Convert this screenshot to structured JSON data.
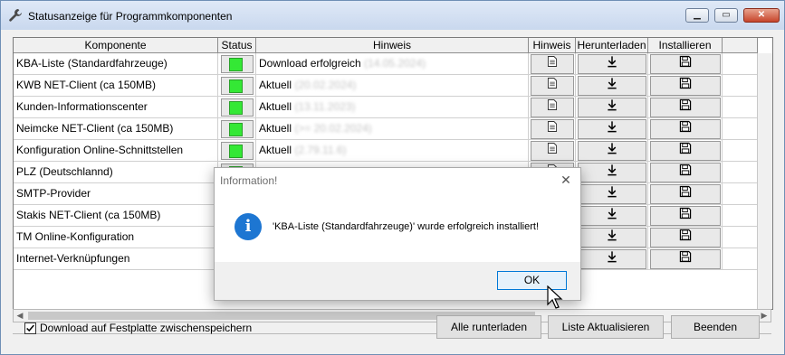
{
  "window": {
    "title": "Statusanzeige für Programmkomponenten",
    "minimize_glyph": "▁",
    "maximize_glyph": "▭",
    "close_glyph": "✕"
  },
  "table": {
    "headers": [
      "Komponente",
      "Status",
      "Hinweis",
      "Hinweis",
      "Herunterladen",
      "Installieren"
    ],
    "rows": [
      {
        "name": "KBA-Liste (Standardfahrzeuge)",
        "status": "green",
        "hint": "Download erfolgreich",
        "hint_detail": "(14.05.2024)"
      },
      {
        "name": "KWB NET-Client (ca 150MB)",
        "status": "green",
        "hint": "Aktuell",
        "hint_detail": "(20.02.2024)"
      },
      {
        "name": "Kunden-Informationscenter",
        "status": "green",
        "hint": "Aktuell",
        "hint_detail": "(13.11.2023)"
      },
      {
        "name": "Neimcke NET-Client (ca 150MB)",
        "status": "green",
        "hint": "Aktuell",
        "hint_detail": "(>= 20.02.2024)"
      },
      {
        "name": "Konfiguration Online-Schnittstellen",
        "status": "green",
        "hint": "Aktuell",
        "hint_detail": "(2.79.11.6)"
      },
      {
        "name": "PLZ (Deutschlannd)",
        "status": "green",
        "hint": "",
        "hint_detail": ""
      },
      {
        "name": "SMTP-Provider",
        "status": "none",
        "hint": "",
        "hint_detail": ""
      },
      {
        "name": "Stakis NET-Client (ca 150MB)",
        "status": "none",
        "hint": "",
        "hint_detail": ""
      },
      {
        "name": "TM Online-Konfiguration",
        "status": "none",
        "hint": "",
        "hint_detail": ""
      },
      {
        "name": "Internet-Verknüpfungen",
        "status": "none",
        "hint": "",
        "hint_detail": ""
      }
    ]
  },
  "icons": {
    "hint": "document-icon",
    "download": "download-icon",
    "install": "floppy-disk-icon"
  },
  "footer": {
    "checkbox_label": "Download auf Festplatte zwischenspeichern",
    "checkbox_checked": true,
    "btn_all": "Alle runterladen",
    "btn_refresh": "Liste Aktualisieren",
    "btn_exit": "Beenden"
  },
  "dialog": {
    "title": "Information!",
    "message": "'KBA-Liste (Standardfahrzeuge)' wurde erfolgreich installiert!",
    "ok_label": "OK",
    "icon": "info-icon"
  },
  "colors": {
    "status_green": "#34e835",
    "info_blue": "#1d76d2",
    "ok_border": "#0078d7"
  }
}
